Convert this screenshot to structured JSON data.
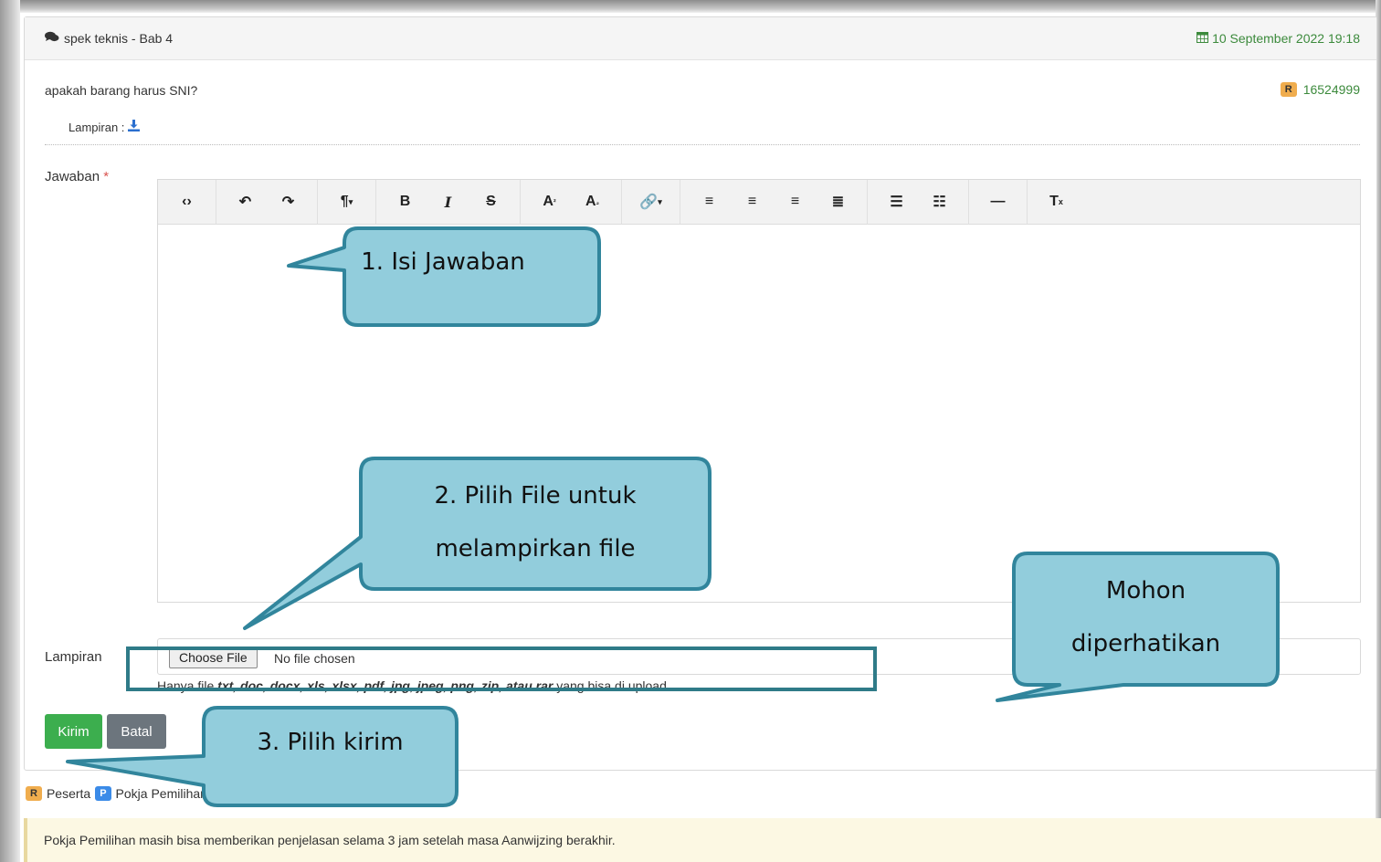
{
  "header": {
    "title": "spek teknis - Bab 4",
    "date": "10 September 2022 19:18"
  },
  "question": {
    "text": "apakah barang harus SNI?",
    "user_badge": "R",
    "user_id": "16524999",
    "attachment_label": "Lampiran :"
  },
  "form": {
    "answer_label": "Jawaban",
    "required_mark": "*",
    "attachment_label": "Lampiran",
    "choose_file_label": "Choose File",
    "no_file_text": "No file chosen",
    "help_prefix": "Hanya file ",
    "help_types": "txt, doc, docx, xls, xlsx, pdf, jpg, jpeg, png, zip, atau rar",
    "help_suffix": " yang bisa di upload.",
    "submit_label": "Kirim",
    "cancel_label": "Batal"
  },
  "toolbar": {
    "icons": [
      "code-view-icon",
      "undo-icon",
      "redo-icon",
      "paragraph-icon",
      "bold-icon",
      "italic-icon",
      "strikethrough-icon",
      "superscript-icon",
      "subscript-icon",
      "link-icon",
      "align-left-icon",
      "align-center-icon",
      "align-right-icon",
      "align-justify-icon",
      "unordered-list-icon",
      "ordered-list-icon",
      "horizontal-rule-icon",
      "clear-format-icon"
    ]
  },
  "legend": {
    "r_badge": "R",
    "r_label": "Peserta",
    "p_badge": "P",
    "p_label": "Pokja Pemilihan"
  },
  "info": {
    "text": "Pokja Pemilihan masih bisa memberikan penjelasan selama 3 jam setelah masa Aanwijzing berakhir."
  },
  "callouts": {
    "c1": "1. Isi Jawaban",
    "c2_line1": "2. Pilih File untuk",
    "c2_line2": "melampirkan file",
    "c3": "3. Pilih kirim",
    "c4_line1": "Mohon",
    "c4_line2": "diperhatikan"
  },
  "colors": {
    "callout_fill": "#92cddc",
    "callout_stroke": "#31859c",
    "accent_green": "#3cae4e",
    "date_green": "#3c8a3c"
  }
}
